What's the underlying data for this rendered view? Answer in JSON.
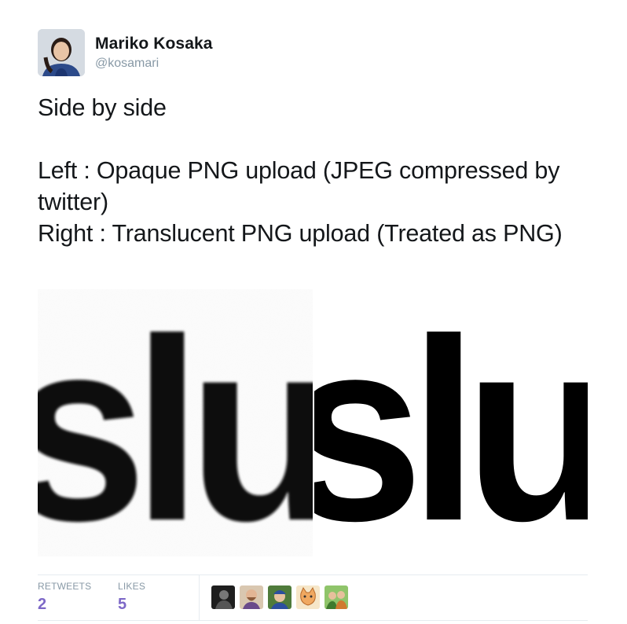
{
  "author": {
    "name": "Mariko Kosaka",
    "handle": "@kosamari",
    "avatar_icon": "user-portrait-avatar"
  },
  "tweet": {
    "text": "Side by side\n\nLeft : Opaque PNG upload (JPEG compressed by twitter)\nRight : Translucent PNG upload (Treated as PNG)"
  },
  "media": {
    "left_text": "slu",
    "right_text": "slu"
  },
  "stats": {
    "retweets_label": "RETWEETS",
    "retweets_count": "2",
    "likes_label": "LIKES",
    "likes_count": "5"
  },
  "likers": [
    {
      "icon": "liker-avatar-dark",
      "color": "#2b2b2b"
    },
    {
      "icon": "liker-avatar-bearded",
      "color": "#c9a27a"
    },
    {
      "icon": "liker-avatar-blue-hat",
      "color": "#3a5f9e"
    },
    {
      "icon": "liker-avatar-cat-drawing",
      "color": "#f0b070"
    },
    {
      "icon": "liker-avatar-green-outdoor",
      "color": "#6aa84f"
    }
  ],
  "colors": {
    "accent": "#7d68c7",
    "muted": "#8899a6",
    "text": "#14171a"
  }
}
